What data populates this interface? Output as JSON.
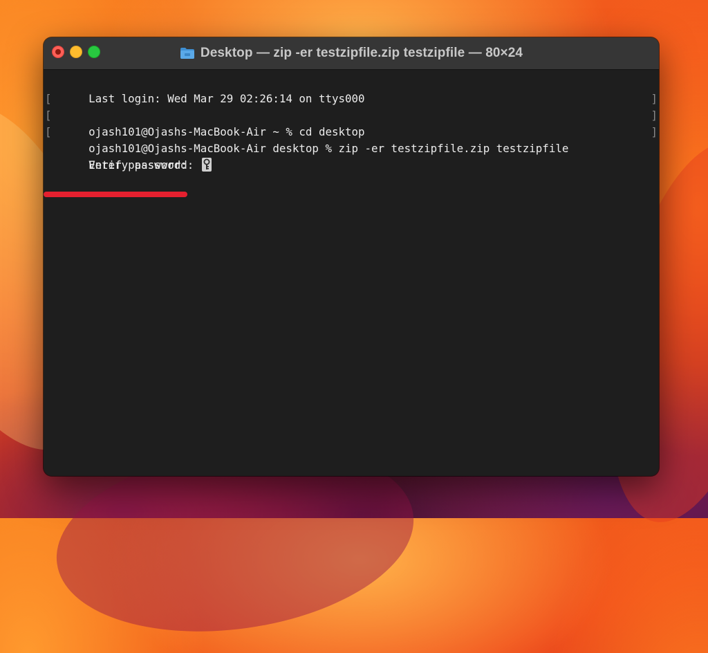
{
  "window": {
    "title": "Desktop — zip -er testzipfile.zip testzipfile — 80×24",
    "title_icon": "folder-icon"
  },
  "terminal": {
    "lines": [
      "Last login: Wed Mar 29 02:26:14 on ttys000",
      "ojash101@Ojashs-MacBook-Air ~ % cd desktop",
      "ojash101@Ojashs-MacBook-Air desktop % zip -er testzipfile.zip testzipfile",
      "Enter password: ",
      "Verify password: "
    ],
    "cursor_icon": "key-icon"
  },
  "colors": {
    "annotation_underline": "#e5202f",
    "terminal_bg": "#1e1e1e",
    "titlebar_bg": "#363636"
  }
}
